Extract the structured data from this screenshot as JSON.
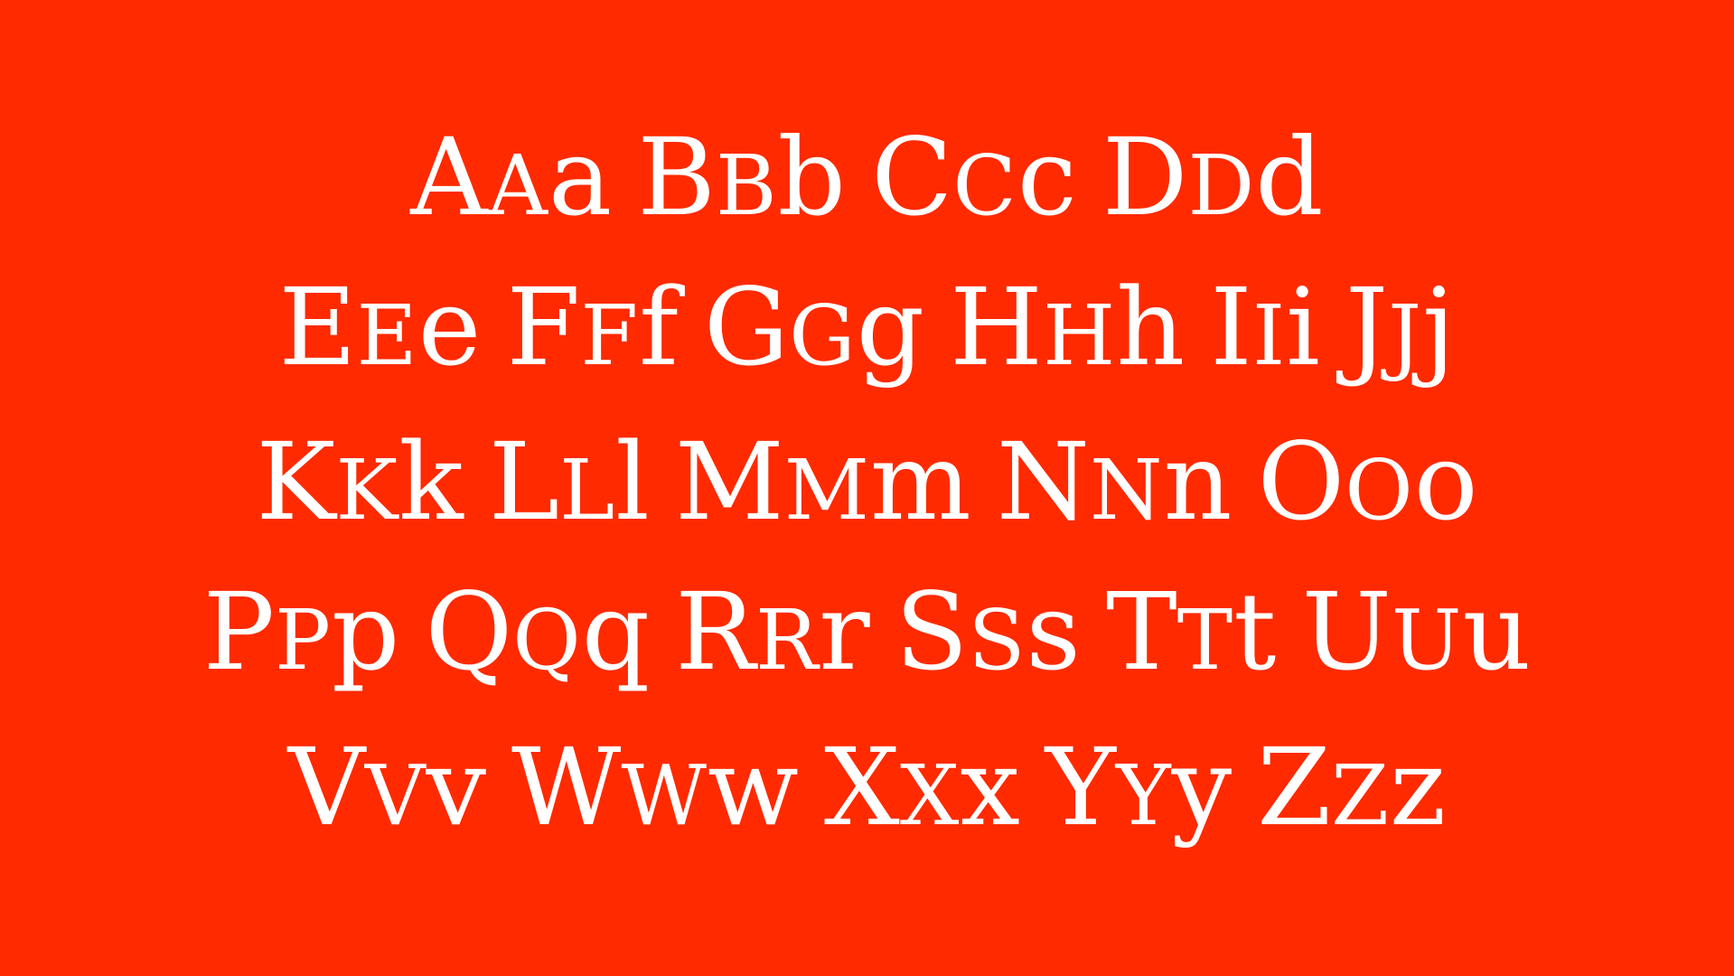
{
  "specimen": {
    "background_color": "#FF2A00",
    "text_color": "#FFFFFF",
    "rows": [
      [
        "Aaa",
        "Bbb",
        "Ccc",
        "Ddd"
      ],
      [
        "Eee",
        "Fff",
        "Ggg",
        "Hhh",
        "Iii",
        "Jjj"
      ],
      [
        "Kkk",
        "Lll",
        "Mmm",
        "Nnn",
        "Ooo"
      ],
      [
        "Ppp",
        "Qqq",
        "Rrr",
        "Sss",
        "Ttt",
        "Uuu"
      ],
      [
        "Vvv",
        "Www",
        "Xxx",
        "Yyy",
        "Zzz"
      ]
    ]
  }
}
